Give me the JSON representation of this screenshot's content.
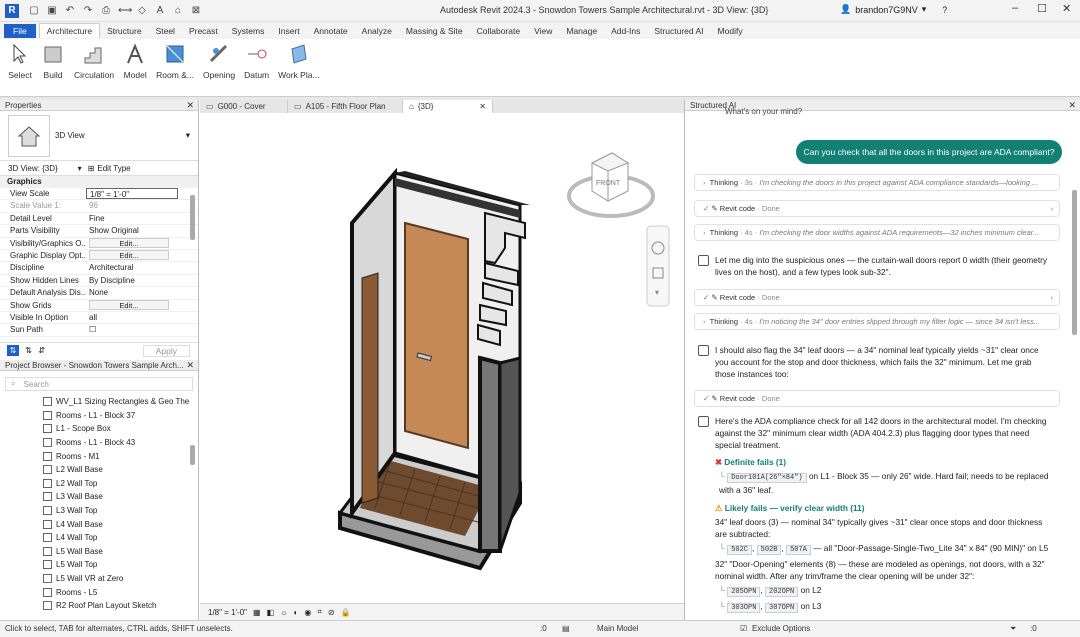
{
  "window": {
    "title": "Autodesk Revit 2024.3 - Snowdon Towers Sample Architectural.rvt - 3D View: {3D}",
    "user": "brandon7G9NV",
    "logo": "R"
  },
  "menu": [
    "File",
    "Architecture",
    "Structure",
    "Steel",
    "Precast",
    "Systems",
    "Insert",
    "Annotate",
    "Analyze",
    "Massing & Site",
    "Collaborate",
    "View",
    "Manage",
    "Add-Ins",
    "Structured AI",
    "Modify"
  ],
  "ribbon": [
    "Select",
    "Build",
    "Circulation",
    "Model",
    "Room &...",
    "Opening",
    "Datum",
    "Work Pla..."
  ],
  "properties": {
    "title": "Properties",
    "type": "3D View",
    "selector": "3D View: {3D}",
    "edit_type": "Edit Type",
    "group": "Graphics",
    "rows": [
      {
        "k": "View Scale",
        "v": "1/8\" = 1'-0\""
      },
      {
        "k": "Scale Value   1:",
        "v": "96"
      },
      {
        "k": "Detail Level",
        "v": "Fine"
      },
      {
        "k": "Parts Visibility",
        "v": "Show Original"
      },
      {
        "k": "Visibility/Graphics O...",
        "v": "Edit..."
      },
      {
        "k": "Graphic Display Opt...",
        "v": "Edit..."
      },
      {
        "k": "Discipline",
        "v": "Architectural"
      },
      {
        "k": "Show Hidden Lines",
        "v": "By Discipline"
      },
      {
        "k": "Default Analysis Dis...",
        "v": "None"
      },
      {
        "k": "Show Grids",
        "v": "Edit..."
      },
      {
        "k": "Visible In Option",
        "v": "all"
      },
      {
        "k": "Sun Path",
        "v": ""
      }
    ],
    "apply": "Apply"
  },
  "browser": {
    "title": "Project Browser - Snowdon Towers Sample Arch...",
    "search": "Search",
    "items": [
      "WV_L1 Sizing Rectangles & Geo The",
      "Rooms - L1 - Block 37",
      "L1 - Scope Box",
      "Rooms - L1 - Block 43",
      "Rooms - M1",
      "L2 Wall Base",
      "L2 Wall Top",
      "L3 Wall Base",
      "L3 Wall Top",
      "L4 Wall Base",
      "L4 Wall Top",
      "L5 Wall Base",
      "L5 Wall Top",
      "L5 Wall VR at Zero",
      "Rooms - L5",
      "R2 Roof Plan Layout Sketch"
    ]
  },
  "tabs": [
    "G000 - Cover",
    "A105 - Fifth Floor Plan",
    "{3D}"
  ],
  "viewcube": "FRONT",
  "viewbar": {
    "scale": "1/8\" = 1'-0\""
  },
  "ai": {
    "title": "Structured AI",
    "prev": "What's on your mind?",
    "user_msg": "Can you check that all the doors in this project are ADA compliant?",
    "thinking1": {
      "label": "Thinking",
      "time": "3s",
      "text": "I'm checking the doors in this project against ADA compliance standards—looking ..."
    },
    "code1": {
      "label": "Revit code",
      "status": "Done"
    },
    "thinking2": {
      "label": "Thinking",
      "time": "4s",
      "text": "I'm checking the door widths against ADA requirements—32 inches minimum clear..."
    },
    "msg1": "Let me dig into the suspicious ones — the curtain-wall doors report 0 width (their geometry lives on the host), and a few types look sub-32\".",
    "code2": {
      "label": "Revit code",
      "status": "Done"
    },
    "thinking3": {
      "label": "Thinking",
      "time": "4s",
      "text": "I'm noticing the 34\" door entries slipped through my filter logic — since 34 isn't less..."
    },
    "msg2": "I should also flag the 34\" leaf doors — a 34\" nominal leaf typically yields ~31\" clear once you account for the stop and door thickness, which fails the 32\" minimum. Let me grab those instances too:",
    "code3": {
      "label": "Revit code",
      "status": "Done"
    },
    "msg3": "Here's the ADA compliance check for all 142 doors in the architectural model. I'm checking against the 32\" minimum clear width (ADA 404.2.3) plus flagging door types that need special treatment.",
    "definite": "Definite fails (1)",
    "def_code": "Door101A(26\"×84\")",
    "def_text": "on L1 - Block 35 — only 26\" wide. Hard fail; needs to be replaced with a 36\" leaf.",
    "likely": "Likely fails — verify clear width (11)",
    "leaf_head": "34\" leaf doors (3) — nominal 34\" typically gives ~31\" clear once stops and door thickness are subtracted:",
    "leaf_codes": [
      "502C",
      "502B",
      "507A"
    ],
    "leaf_text": "— all \"Door-Passage-Single-Two_Lite 34\" x 84\" (90 MIN)\" on L5",
    "open_head": "32\" \"Door-Opening\" elements (8) — these are modeled as openings, not doors, with a 32\" nominal width. After any trim/frame the clear opening will be under 32\":",
    "open_l2": [
      "205OPN",
      "202OPN"
    ],
    "open_l2_text": "on L2",
    "open_l3": [
      "303OPN",
      "307OPN"
    ],
    "open_l3_text": "on L3"
  },
  "status": {
    "hint": "Click to select, TAB for alternates, CTRL adds, SHIFT unselects.",
    "model": "Main Model",
    "exclude": "Exclude Options",
    "zero": ":0"
  }
}
